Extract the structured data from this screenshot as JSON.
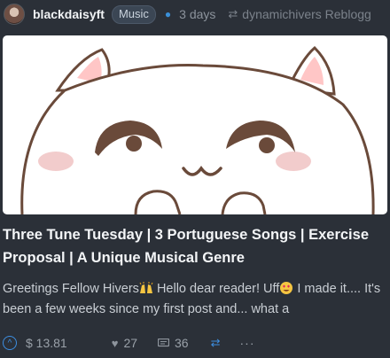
{
  "post": {
    "author": "blackdaisyft",
    "community": "Music",
    "time_ago": "3 days",
    "reblogged_by": "dynamichivers Reblogg",
    "title": "Three Tune Tuesday | 3 Portuguese Songs | Exercise Proposal | A Unique Musical Genre",
    "excerpt_part1": "Greetings Fellow Hivers",
    "excerpt_part2": " Hello dear reader! Uff",
    "excerpt_part3": " I made it.... It's been a few weeks since my first post and... what a",
    "emoji_1": "raising-hands-emoji",
    "emoji_2": "heart-eyes-emoji"
  },
  "footer": {
    "payout": "$ 13.81",
    "votes": "27",
    "comments": "36",
    "more": "···"
  },
  "colors": {
    "background": "#2b3038",
    "accent_blue": "#3d8ee0",
    "muted_text": "#8c939c"
  }
}
